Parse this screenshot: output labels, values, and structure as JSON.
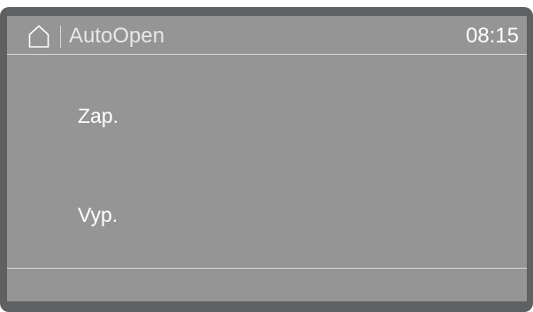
{
  "header": {
    "home_icon": "home-icon",
    "title": "AutoOpen",
    "time": "08:15"
  },
  "options": [
    {
      "label": "Zap."
    },
    {
      "label": "Vyp."
    }
  ],
  "colors": {
    "bezel": "#5f6062",
    "screen": "#959596",
    "text": "#ffffff",
    "divider": "#d9d9da"
  }
}
